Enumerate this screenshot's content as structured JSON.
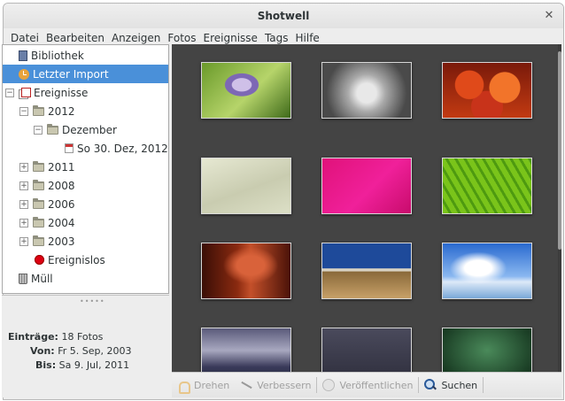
{
  "window": {
    "title": "Shotwell",
    "close_glyph": "✕"
  },
  "menubar": {
    "items": [
      "Datei",
      "Bearbeiten",
      "Anzeigen",
      "Fotos",
      "Ereignisse",
      "Tags",
      "Hilfe"
    ]
  },
  "sidebar": {
    "library": {
      "label": "Bibliothek",
      "icon": "library-icon"
    },
    "last_import": {
      "label": "Letzter Import",
      "icon": "clock-icon",
      "selected": true
    },
    "events": {
      "label": "Ereignisse",
      "icon": "events-icon"
    },
    "years": [
      {
        "label": "2012",
        "expanded": true
      },
      {
        "label": "2011",
        "expanded": false
      },
      {
        "label": "2008",
        "expanded": false
      },
      {
        "label": "2006",
        "expanded": false
      },
      {
        "label": "2004",
        "expanded": false
      },
      {
        "label": "2003",
        "expanded": false
      }
    ],
    "month": {
      "label": "Dezember"
    },
    "day": {
      "label": "So 30. Dez, 2012"
    },
    "no_event": {
      "label": "Ereignislos"
    },
    "trash": {
      "label": "Müll"
    }
  },
  "info": {
    "entries_label": "Einträge:",
    "entries_value": "18 Fotos",
    "from_label": "Von:",
    "from_value": "Fr 5. Sep, 2003",
    "to_label": "Bis:",
    "to_value": "Sa 9. Jul, 2011"
  },
  "toolbar": {
    "rotate": "Drehen",
    "enhance": "Verbessern",
    "publish": "Veröffentlichen",
    "search": "Suchen"
  },
  "thumbnails": [
    {
      "desc": "lavender flower on green",
      "bg": "radial-gradient(ellipse at 45% 40%, #cfc0e8 0 14%, #7d68b5 15% 24%, transparent 25%), linear-gradient(135deg,#6a9a2a,#b6d46a 55%,#3f6a1a)"
    },
    {
      "desc": "dandelion seeds gray",
      "bg": "radial-gradient(circle at 50% 55%, #e8e8e8 0 18%, #a9a9a9 35%, #4a4a4a 75%)"
    },
    {
      "desc": "red orange tulips",
      "bg": "radial-gradient(circle at 30% 40%, #e04a1a 0 20%, transparent 21%), radial-gradient(circle at 70% 45%, #f2742a 0 22%, transparent 23%), radial-gradient(circle at 50% 80%, #c8331a 0 25%, transparent 26%), linear-gradient(#7a1a0a,#c23a12)"
    },
    {
      "desc": "pale sand texture",
      "bg": "linear-gradient(160deg,#e6e8d2,#c9ccb0 55%,#dcdfc6)"
    },
    {
      "desc": "magenta pink fabric",
      "bg": "linear-gradient(135deg,#e0127a,#f0209a 55%,#c80c6c)"
    },
    {
      "desc": "green leaf macro",
      "bg": "repeating-linear-gradient(60deg,#7ac41a 0 6px,#4e9a10 6px 9px)"
    },
    {
      "desc": "red canyon",
      "bg": "radial-gradient(ellipse at 55% 40%, #d9623a 0 20%, transparent 40%), linear-gradient(90deg,#3a0e06,#8a2a10 40%,#c4502a 55%,#4a1208)"
    },
    {
      "desc": "desert road blue sky",
      "bg": "linear-gradient(#1e4a9a 0 45%, #d8d2c2 46% 50%, #8a6a3a 52%, #c7a068)"
    },
    {
      "desc": "blue sky clouds sea",
      "bg": "radial-gradient(ellipse at 40% 45%, #ffffff 0 18%, transparent 38%), linear-gradient(#2a6ad0,#8ab8f0 60%,#dde9f8 70%,#7aa8d8)"
    },
    {
      "desc": "sunset over water",
      "bg": "linear-gradient(#5a5a7a,#a8a8c0 40%,#3a3a5a 70%,#22283a)"
    },
    {
      "desc": "dark purple gradient",
      "bg": "linear-gradient(#4a4a5c,#2e2e3c)"
    },
    {
      "desc": "dark green gradient",
      "bg": "radial-gradient(ellipse at 50% 40%, #4a8a5a, #183a22 80%)"
    }
  ]
}
